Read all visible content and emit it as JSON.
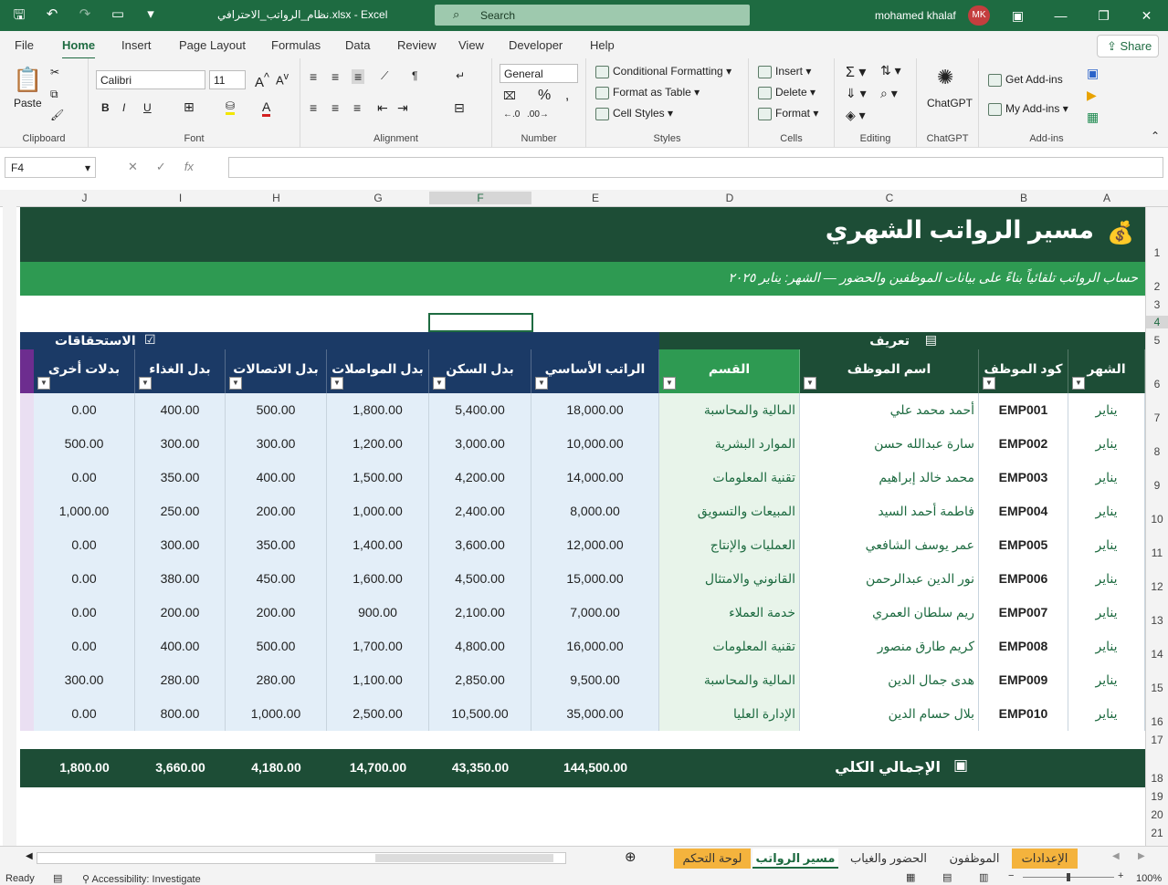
{
  "titlebar": {
    "filename": "نظام_الرواتب_الاحترافي.xlsx  -  Excel",
    "search": "Search",
    "user": "mohamed khalaf",
    "initials": "MK"
  },
  "tabs": [
    "File",
    "Home",
    "Insert",
    "Page Layout",
    "Formulas",
    "Data",
    "Review",
    "View",
    "Developer",
    "Help"
  ],
  "share": "Share",
  "ribbon": {
    "paste": "Paste",
    "clipboard": "Clipboard",
    "font_name": "Calibri",
    "font_size": "11",
    "font": "Font",
    "alignment": "Alignment",
    "number_format": "General",
    "number": "Number",
    "cond": "Conditional Formatting",
    "fmt_table": "Format as Table",
    "cell_styles": "Cell Styles",
    "styles": "Styles",
    "insert": "Insert",
    "delete": "Delete",
    "format": "Format",
    "cells": "Cells",
    "editing": "Editing",
    "chatgpt": "ChatGPT",
    "get_addins": "Get Add-ins",
    "my_addins": "My Add-ins",
    "addins": "Add-ins"
  },
  "namebox": "F4",
  "columns": [
    "J",
    "I",
    "H",
    "G",
    "F",
    "E",
    "D",
    "C",
    "B",
    "A"
  ],
  "rows": [
    "1",
    "2",
    "3",
    "4",
    "5",
    "6",
    "7",
    "8",
    "9",
    "10",
    "11",
    "12",
    "13",
    "14",
    "15",
    "16",
    "17",
    "18",
    "19",
    "20",
    "21"
  ],
  "sheet": {
    "title": "مسير الرواتب الشهري",
    "subtitle": "حساب الرواتب تلقائياً بناءً على بيانات الموظفين والحضور — الشهر: يناير ٢٠٢٥",
    "sec_left": "الاستحقاقات",
    "sec_right": "تعريف",
    "headers": [
      "بدلات أخرى",
      "بدل الغذاء",
      "بدل الاتصالات",
      "بدل المواصلات",
      "بدل السكن",
      "الراتب الأساسي",
      "القسم",
      "اسم الموظف",
      "كود الموظف",
      "الشهر"
    ],
    "total_label": "الإجمالي الكلي",
    "totals": [
      "1,800.00",
      "3,660.00",
      "4,180.00",
      "14,700.00",
      "43,350.00",
      "144,500.00"
    ]
  },
  "data": [
    [
      "0.00",
      "400.00",
      "500.00",
      "1,800.00",
      "5,400.00",
      "18,000.00",
      "المالية والمحاسبة",
      "أحمد محمد علي",
      "EMP001",
      "يناير"
    ],
    [
      "500.00",
      "300.00",
      "300.00",
      "1,200.00",
      "3,000.00",
      "10,000.00",
      "الموارد البشرية",
      "سارة عبدالله حسن",
      "EMP002",
      "يناير"
    ],
    [
      "0.00",
      "350.00",
      "400.00",
      "1,500.00",
      "4,200.00",
      "14,000.00",
      "تقنية المعلومات",
      "محمد خالد إبراهيم",
      "EMP003",
      "يناير"
    ],
    [
      "1,000.00",
      "250.00",
      "200.00",
      "1,000.00",
      "2,400.00",
      "8,000.00",
      "المبيعات والتسويق",
      "فاطمة أحمد السيد",
      "EMP004",
      "يناير"
    ],
    [
      "0.00",
      "300.00",
      "350.00",
      "1,400.00",
      "3,600.00",
      "12,000.00",
      "العمليات والإنتاج",
      "عمر يوسف الشافعي",
      "EMP005",
      "يناير"
    ],
    [
      "0.00",
      "380.00",
      "450.00",
      "1,600.00",
      "4,500.00",
      "15,000.00",
      "القانوني والامتثال",
      "نور الدين عبدالرحمن",
      "EMP006",
      "يناير"
    ],
    [
      "0.00",
      "200.00",
      "200.00",
      "900.00",
      "2,100.00",
      "7,000.00",
      "خدمة العملاء",
      "ريم سلطان العمري",
      "EMP007",
      "يناير"
    ],
    [
      "0.00",
      "400.00",
      "500.00",
      "1,700.00",
      "4,800.00",
      "16,000.00",
      "تقنية المعلومات",
      "كريم طارق منصور",
      "EMP008",
      "يناير"
    ],
    [
      "300.00",
      "280.00",
      "280.00",
      "1,100.00",
      "2,850.00",
      "9,500.00",
      "المالية والمحاسبة",
      "هدى جمال الدين",
      "EMP009",
      "يناير"
    ],
    [
      "0.00",
      "800.00",
      "1,000.00",
      "2,500.00",
      "10,500.00",
      "35,000.00",
      "الإدارة العليا",
      "بلال حسام الدين",
      "EMP010",
      "يناير"
    ]
  ],
  "sheettabs": [
    "لوحة التحكم",
    "مسير الرواتب",
    "الحضور والغياب",
    "الموظفون",
    "الإعدادات"
  ],
  "status": {
    "ready": "Ready",
    "access": "Accessibility: Investigate",
    "zoom": "100%"
  }
}
